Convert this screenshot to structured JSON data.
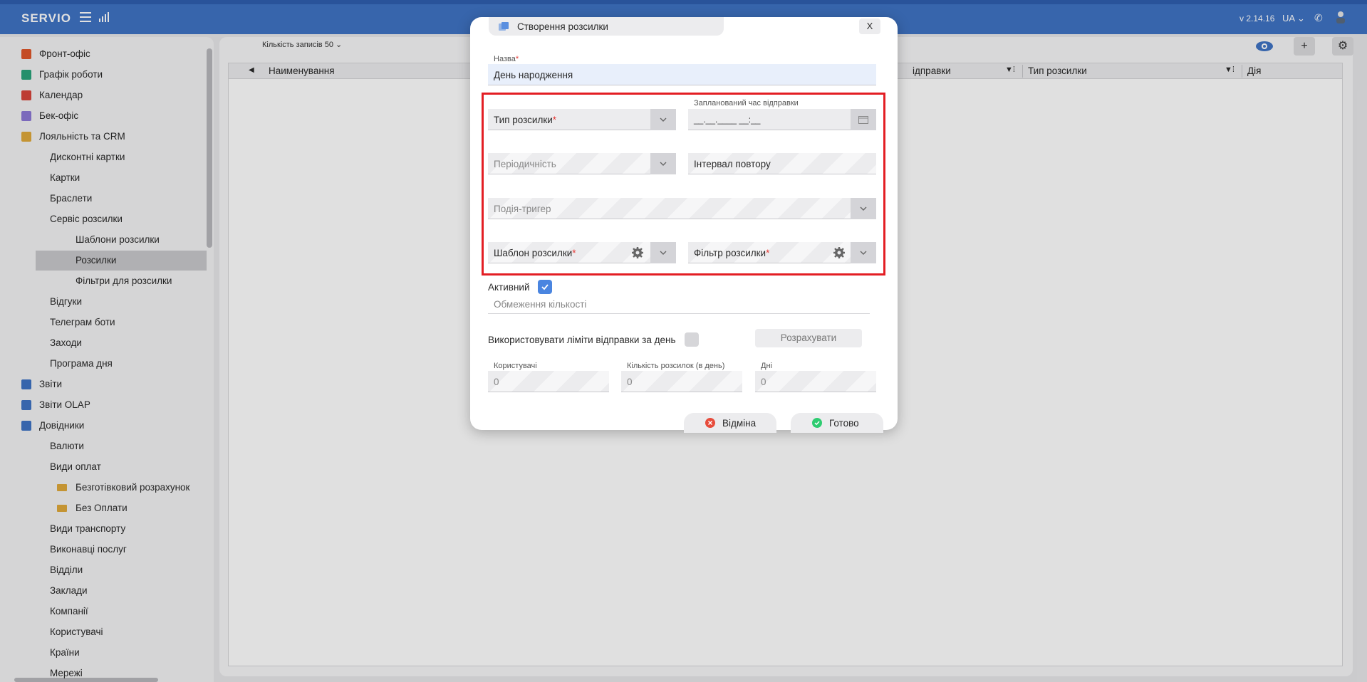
{
  "topbar": {
    "logo": "SERVIO",
    "version": "v 2.14.16",
    "language": "UA"
  },
  "sidebar": {
    "items": [
      {
        "label": "Фронт-офіс",
        "icon": "briefcase-icon",
        "color": "#e0572b"
      },
      {
        "label": "Графік роботи",
        "icon": "clock-icon",
        "color": "#2aa37a"
      },
      {
        "label": "Календар",
        "icon": "calendar-icon",
        "color": "#d8453b"
      },
      {
        "label": "Бек-офіс",
        "icon": "list-icon",
        "color": "#8d78d6"
      },
      {
        "label": "Лояльність та CRM",
        "icon": "people-icon",
        "color": "#e0a93b"
      },
      {
        "label": "Дисконтні картки"
      },
      {
        "label": "Картки"
      },
      {
        "label": "Браслети"
      },
      {
        "label": "Сервіс розсилки"
      },
      {
        "label": "Шаблони розсилки"
      },
      {
        "label": "Розсилки"
      },
      {
        "label": "Фільтри для розсилки"
      },
      {
        "label": "Відгуки"
      },
      {
        "label": "Телеграм боти"
      },
      {
        "label": "Заходи"
      },
      {
        "label": "Програма дня"
      },
      {
        "label": "Звіти",
        "icon": "report-icon",
        "color": "#3f73c4"
      },
      {
        "label": "Звіти OLAP",
        "icon": "report-olap-icon",
        "color": "#3f73c4"
      },
      {
        "label": "Довідники",
        "icon": "book-icon",
        "color": "#3f73c4"
      },
      {
        "label": "Валюти"
      },
      {
        "label": "Види оплат"
      },
      {
        "label": "Безготівковий розрахунок",
        "icon": "folder-icon"
      },
      {
        "label": "Без Оплати",
        "icon": "folder-icon"
      },
      {
        "label": "Види транспорту"
      },
      {
        "label": "Виконавці послуг"
      },
      {
        "label": "Відділи"
      },
      {
        "label": "Заклади"
      },
      {
        "label": "Компанії"
      },
      {
        "label": "Користувачі"
      },
      {
        "label": "Країни"
      },
      {
        "label": "Мережі"
      }
    ]
  },
  "main": {
    "records_label": "Кількість записів",
    "records_value": "50",
    "columns": [
      "Наименування",
      "ідправки",
      "Тип розсилки",
      "Дія"
    ]
  },
  "dialog": {
    "title": "Створення розсилки",
    "close": "X",
    "name_label": "Назва",
    "name_value": "День народження",
    "mailing_type": "Тип розсилки",
    "scheduled_label": "Запланований час відправки",
    "scheduled_value": "__.__.____ __:__",
    "periodicity": "Періодичність",
    "repeat_interval": "Інтервал повтору",
    "trigger_event": "Подія-тригер",
    "template": "Шаблон розсилки",
    "filter": "Фільтр розсилки",
    "active_label": "Активний",
    "limit_placeholder": "Обмеження кількості",
    "use_limits_label": "Використовувати ліміти відправки за день",
    "calculate_button": "Розрахувати",
    "users_label": "Користувачі",
    "users_value": "0",
    "per_day_label": "Кількість розсилок (в день)",
    "per_day_value": "0",
    "days_label": "Дні",
    "days_value": "0",
    "cancel_button": "Відміна",
    "done_button": "Готово"
  },
  "colors": {
    "topbar": "#3f73c4",
    "accent": "#4a85e0",
    "highlight": "#e31e24",
    "cancel": "#e74c3c",
    "done": "#2ecc71"
  }
}
